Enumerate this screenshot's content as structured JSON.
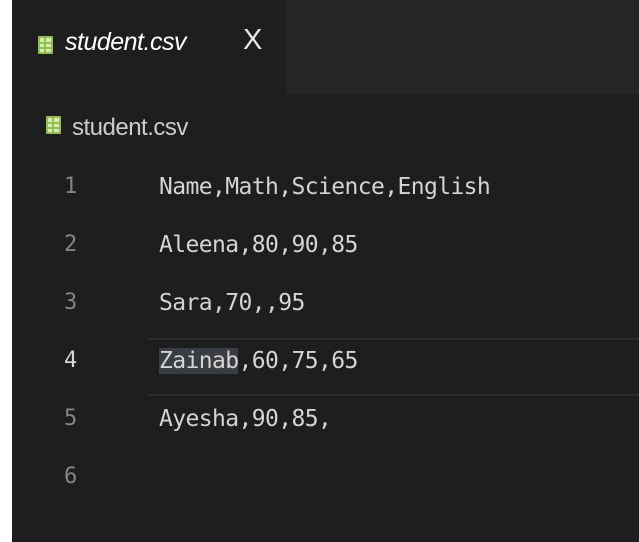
{
  "tab": {
    "filename": "student.csv",
    "close_glyph": "X"
  },
  "breadcrumb": {
    "label": "student.csv"
  },
  "editor": {
    "current_line": 4,
    "lines": [
      {
        "number": "1",
        "text": "Name,Math,Science,English"
      },
      {
        "number": "2",
        "text": "Aleena,80,90,85"
      },
      {
        "number": "3",
        "text": "Sara,70,,95"
      },
      {
        "number": "4",
        "selected": "Zainab",
        "rest": ",60,75,65"
      },
      {
        "number": "5",
        "text": "Ayesha,90,85,"
      },
      {
        "number": "6",
        "text": ""
      }
    ]
  },
  "colors": {
    "editor_bg": "#1e1e1e",
    "tabbar_bg": "#252526",
    "csv_icon": "#8fc14c",
    "text": "#d4d4d4",
    "line_number": "#858585",
    "selection": "#3a3d41"
  },
  "icons": {
    "file_icon": "csv-file-icon",
    "close_icon": "close-icon"
  }
}
